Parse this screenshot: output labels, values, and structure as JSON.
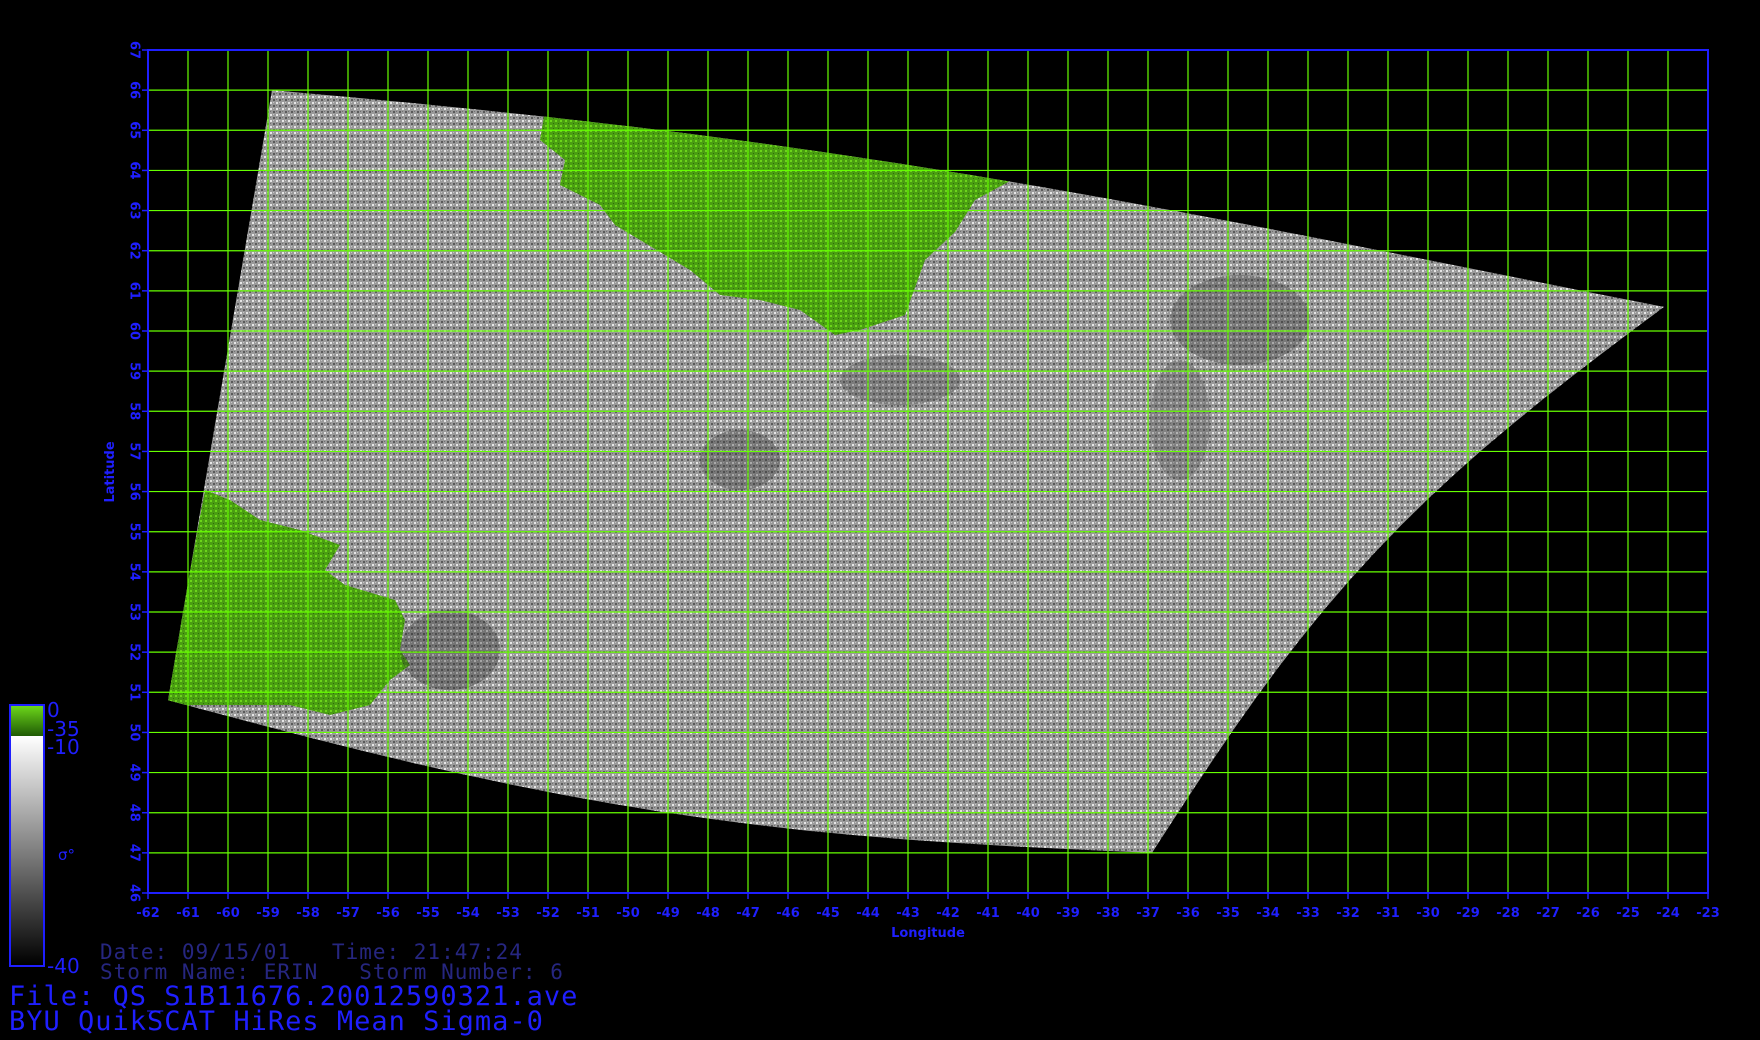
{
  "map": {
    "x_axis_label": "Longitude",
    "y_axis_label": "Latitude",
    "lon_ticks": [
      "-62",
      "-61",
      "-60",
      "-59",
      "-58",
      "-57",
      "-56",
      "-55",
      "-54",
      "-53",
      "-52",
      "-51",
      "-50",
      "-49",
      "-48",
      "-47",
      "-46",
      "-45",
      "-44",
      "-43",
      "-42",
      "-41",
      "-40",
      "-39",
      "-38",
      "-37",
      "-36",
      "-35",
      "-34",
      "-33",
      "-32",
      "-31",
      "-30",
      "-29",
      "-28",
      "-27",
      "-26",
      "-25",
      "-24",
      "-23"
    ],
    "lat_ticks": [
      "46",
      "47",
      "48",
      "49",
      "50",
      "51",
      "52",
      "53",
      "54",
      "55",
      "56",
      "57",
      "58",
      "59",
      "60",
      "61",
      "62",
      "63",
      "64",
      "65",
      "66",
      "67"
    ],
    "lon_range": [
      -62,
      -23
    ],
    "lat_range": [
      46,
      67
    ],
    "swath_corners": [
      {
        "lon": -61.5,
        "lat": 50.8
      },
      {
        "lon": -58.9,
        "lat": 66.0
      },
      {
        "lon": -24.1,
        "lat": 60.6
      },
      {
        "lon": -36.9,
        "lat": 47.0
      }
    ],
    "grid_color": "#66ff00",
    "frame_color": "#1f1fff",
    "land_color": "#4caa10",
    "ocean_color": "#8f8f8f"
  },
  "colorbar": {
    "tick_top": "0",
    "tick_upper": "-35",
    "tick_mid": "-10",
    "tick_bottom": "-40",
    "symbol": "σ°"
  },
  "meta": {
    "date_line": "Date: 09/15/01   Time: 21:47:24",
    "storm_line": "Storm Name: ERIN   Storm Number: 6",
    "file_line": "File: QS_S1B11676.20012590321.ave",
    "title_line": "BYU QuikSCAT HiRes Mean Sigma-0"
  }
}
